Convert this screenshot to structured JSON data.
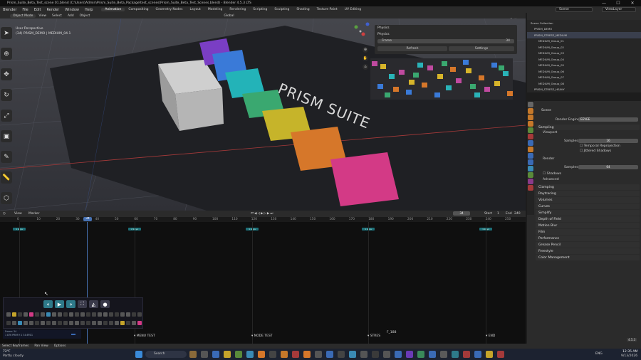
{
  "window": {
    "title": "Prism_Suite_Beta_Test_scene 01.blend (C:\\Users\\Admin\\Prism_Suite_Beta_Package\\test_scenes\\Prism_Suite_Beta_Test_Scenes.blend) - Blender 4.5.3 LTS",
    "minimize": "—",
    "maximize": "☐",
    "close": "✕"
  },
  "menubar": {
    "items": [
      "Blender",
      "File",
      "Edit",
      "Render",
      "Window",
      "Help"
    ],
    "workspaces": [
      "Animation",
      "Compositing",
      "Geometry Nodes",
      "Layout",
      "Modeling",
      "Rendering",
      "Scripting",
      "Sculpting",
      "Shading",
      "Texture Paint",
      "UV Editing"
    ],
    "active_workspace": "Animation",
    "scene_label": "Scene",
    "viewlayer_label": "ViewLayer"
  },
  "viewport_header": {
    "mode": "Object Mode",
    "menus": [
      "View",
      "Select",
      "Add",
      "Object"
    ],
    "transform": "Global",
    "options": "Options"
  },
  "viewport": {
    "perspective": "User Perspective",
    "collection": "(34) PRISM_DEMO | MEDIUM_04.1",
    "scene_text": "PRISM SUITE"
  },
  "physics_panel": {
    "tab": "Physics",
    "title": "Physics",
    "frame_label": "Frame",
    "frame_value": "34",
    "refresh": "Refresh",
    "settings": "Settings"
  },
  "outliner": {
    "rows": [
      "Scene Collection",
      "PRISM_DEMO",
      "PRISM_STRESS_MEDIUM",
      "MEDIUM_Group_01",
      "MEDIUM_Group_02",
      "MEDIUM_Group_03",
      "MEDIUM_Group_04",
      "MEDIUM_Group_05",
      "MEDIUM_Group_06",
      "MEDIUM_Group_07",
      "MEDIUM_Group_08",
      "PRISM_STRESS_HEAVY"
    ]
  },
  "properties": {
    "scene": "Scene",
    "render_engine_label": "Render Engine",
    "render_engine": "EEVEE",
    "sampling": "Sampling",
    "viewport": "Viewport",
    "samples_label": "Samples",
    "viewport_samples": "16",
    "temporal": "Temporal Reprojection",
    "jittered": "Jittered Shadows",
    "render": "Render",
    "render_samples": "64",
    "shadows": "Shadows",
    "advanced": "Advanced",
    "sections": [
      "Clamping",
      "Raytracing",
      "Volumes",
      "Curves",
      "Simplify",
      "Depth of Field",
      "Motion Blur",
      "Film",
      "Performance",
      "Grease Pencil",
      "Freestyle",
      "Color Management"
    ]
  },
  "timeline_header": {
    "menus": [
      "View",
      "Marker"
    ],
    "current_frame": "34",
    "start_label": "Start",
    "start": "1",
    "end_label": "End",
    "end": "240"
  },
  "timeline": {
    "ticks": [
      "0",
      "10",
      "20",
      "30",
      "40",
      "50",
      "60",
      "70",
      "80",
      "90",
      "100",
      "110",
      "120",
      "130",
      "140",
      "150",
      "160",
      "170",
      "180",
      "190",
      "200",
      "210",
      "220",
      "230",
      "240",
      "250"
    ],
    "playhead": "34",
    "markers": [
      "MENU TEST",
      "NODE TEST",
      "STRES",
      "F_188",
      "END"
    ],
    "key_labels": [
      "1 keys",
      "2 keys",
      "1 keys",
      "1 keys",
      "1 keys"
    ]
  },
  "float_panel": {
    "status_line1": "Frame: 34",
    "status_line2": "1  876   PRIM  H   1 34.6FSG"
  },
  "statusbar": {
    "items": [
      "Select Keyframes",
      "Pan View",
      "Options"
    ]
  },
  "taskbar": {
    "weather_temp": "72°F",
    "weather_text": "Partly cloudy",
    "search": "Search",
    "lang": "ENG",
    "time": "12:35 AM",
    "date": "9/13/2026",
    "version": "4.5.3"
  }
}
